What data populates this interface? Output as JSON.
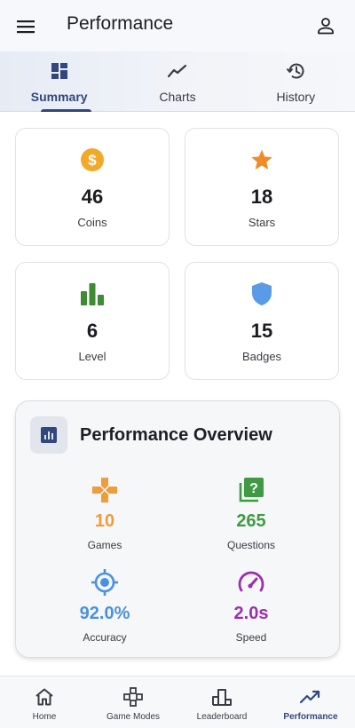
{
  "app_bar": {
    "title": "Performance"
  },
  "tabs": [
    {
      "label": "Summary",
      "icon": "dashboard-icon",
      "active": true
    },
    {
      "label": "Charts",
      "icon": "trend-line-icon",
      "active": false
    },
    {
      "label": "History",
      "icon": "history-icon",
      "active": false
    }
  ],
  "stats": [
    {
      "value": "46",
      "label": "Coins",
      "icon": "coin-icon",
      "color": "#f2a929"
    },
    {
      "value": "18",
      "label": "Stars",
      "icon": "star-icon",
      "color": "#f08c26"
    },
    {
      "value": "6",
      "label": "Level",
      "icon": "bar-chart-icon",
      "color": "#3f8a33"
    },
    {
      "value": "15",
      "label": "Badges",
      "icon": "shield-icon",
      "color": "#5a9be8"
    }
  ],
  "overview": {
    "title": "Performance Overview",
    "metrics": [
      {
        "value": "10",
        "label": "Games",
        "icon": "gamepad-icon",
        "color": "#ee9c3c"
      },
      {
        "value": "265",
        "label": "Questions",
        "icon": "quiz-icon",
        "color": "#3f9a43"
      },
      {
        "value": "92.0%",
        "label": "Accuracy",
        "icon": "target-icon",
        "color": "#4a90e2"
      },
      {
        "value": "2.0s",
        "label": "Speed",
        "icon": "speedometer-icon",
        "color": "#9b2fae"
      }
    ]
  },
  "bottom_nav": [
    {
      "label": "Home",
      "icon": "home-icon",
      "active": false
    },
    {
      "label": "Game Modes",
      "icon": "game-modes-icon",
      "active": false
    },
    {
      "label": "Leaderboard",
      "icon": "leaderboard-icon",
      "active": false
    },
    {
      "label": "Performance",
      "icon": "trending-up-icon",
      "active": true
    }
  ],
  "colors": {
    "accent": "#33477f"
  }
}
